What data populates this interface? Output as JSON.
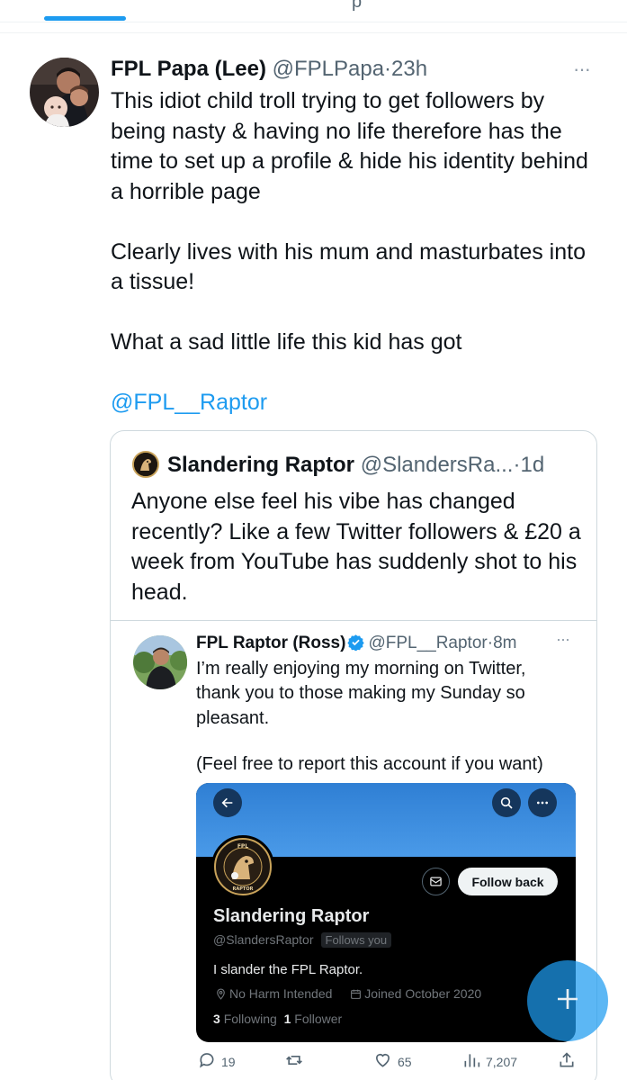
{
  "tabs": {
    "partial_label": "p"
  },
  "tweet": {
    "display_name": "FPL Papa (Lee)",
    "handle": "@FPLPapa",
    "separator": "·",
    "time": "23h",
    "more": "···",
    "paragraph_1": "This idiot child troll trying to get followers by being nasty & having no life therefore has the time to set up a profile & hide his identity behind a horrible page",
    "paragraph_2": "Clearly lives with his mum and masturbates into a tissue!",
    "paragraph_3": "What a sad little life this kid has got",
    "mention": "@FPL__Raptor"
  },
  "quote": {
    "display_name": "Slandering Raptor",
    "handle": "@SlandersRa...",
    "separator": "·",
    "time": "1d",
    "text": "Anyone else feel his vibe has changed recently? Like a few Twitter followers & £20 a week from YouTube has suddenly shot to his head."
  },
  "nested": {
    "display_name": "FPL Raptor (Ross)",
    "handle": "@FPL__Raptor",
    "separator": "·",
    "time": "8m",
    "more": "···",
    "paragraph_1": "I’m really enjoying my morning on Twitter, thank you to those making my Sunday so pleasant.",
    "paragraph_2": "(Feel free to report this account if you want)"
  },
  "profile_shot": {
    "avatar_top_text": "FPL",
    "avatar_bottom_text": "RAPTOR",
    "follow_back_label": "Follow back",
    "name": "Slandering Raptor",
    "handle": "@SlandersRaptor",
    "follows_you": "Follows you",
    "bio": "I slander the FPL Raptor.",
    "location": "No Harm Intended",
    "joined": "Joined October 2020",
    "following_count": "3",
    "following_label": "Following",
    "followers_count": "1",
    "followers_label": "Follower"
  },
  "actions": {
    "replies": "19",
    "retweets": "",
    "likes": "65",
    "views": "7,207"
  },
  "colors": {
    "accent": "#1d9bf0",
    "secondary_text": "#536471",
    "border": "#cfd9de",
    "banner": "#4a9ae8"
  },
  "icons": [
    "more-icon",
    "verified-icon",
    "back-arrow-icon",
    "search-icon",
    "mail-icon",
    "location-icon",
    "calendar-icon",
    "reply-icon",
    "retweet-icon",
    "like-icon",
    "views-icon",
    "share-icon",
    "compose-plus-icon"
  ]
}
